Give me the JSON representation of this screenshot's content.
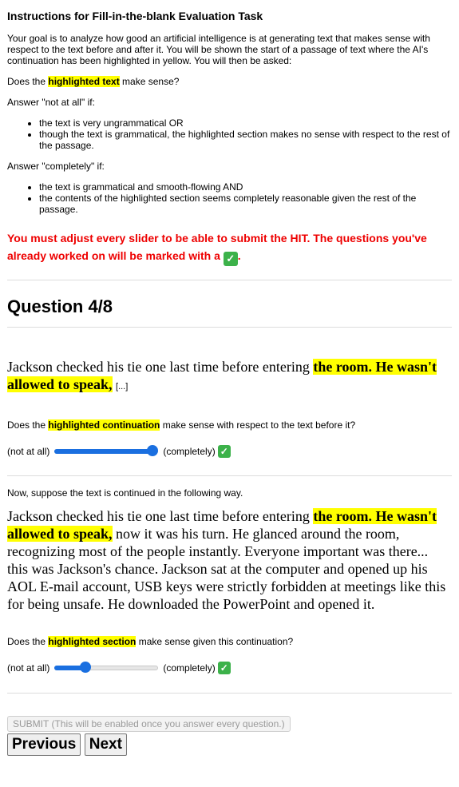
{
  "instructions": {
    "title": "Instructions for Fill-in-the-blank Evaluation Task",
    "intro": "Your goal is to analyze how good an artificial intelligence is at generating text that makes sense with respect to the text before and after it. You will be shown the start of a passage of text where the AI's continuation has been highlighted in yellow. You will then be asked:",
    "question_prefix": "Does the ",
    "question_highlight": "highlighted text",
    "question_suffix": " make sense?",
    "not_at_all_intro": "Answer \"not at all\" if:",
    "not_at_all_items": [
      "the text is very ungrammatical OR",
      "though the text is grammatical, the highlighted section makes no sense with respect to the rest of the passage."
    ],
    "completely_intro": "Answer \"completely\" if:",
    "completely_items": [
      "the text is grammatical and smooth-flowing AND",
      "the contents of the highlighted section seems completely reasonable given the rest of the passage."
    ],
    "warning_text": "You must adjust every slider to be able to submit the HIT. The questions you've already worked on will be marked with a",
    "warning_end": "."
  },
  "question": {
    "heading": "Question 4/8",
    "passage_start": "Jackson checked his tie one last time before entering ",
    "passage_highlight": "the room. He wasn't allowed to speak,",
    "ellipsis": "[...]",
    "q1_prefix": "Does the ",
    "q1_highlight": "highlighted continuation",
    "q1_suffix": " make sense with respect to the text before it?",
    "slider1": {
      "left_label": "(not at all)",
      "right_label": "(completely)",
      "value": 1.0,
      "answered": true
    },
    "continuation_intro": "Now, suppose the text is continued in the following way.",
    "full_start": "Jackson checked his tie one last time before entering ",
    "full_highlight": "the room. He wasn't allowed to speak,",
    "full_rest": " now it was his turn. He glanced around the room, recognizing most of the people instantly. Everyone important was there... this was Jackson's chance. Jackson sat at the computer and opened up his AOL E-mail account, USB keys were strictly forbidden at meetings like this for being unsafe. He downloaded the PowerPoint and opened it.",
    "q2_prefix": "Does the ",
    "q2_highlight": "highlighted section",
    "q2_suffix": " make sense given this continuation?",
    "slider2": {
      "left_label": "(not at all)",
      "right_label": "(completely)",
      "value": 0.27,
      "answered": true
    }
  },
  "controls": {
    "submit_label": "SUBMIT (This will be enabled once you answer every question.)",
    "previous_label": "Previous",
    "next_label": "Next"
  },
  "colors": {
    "highlight": "#ffff00",
    "warning": "#ee0000",
    "slider": "#1a6fe0",
    "check": "#3cb24a"
  },
  "icons": {
    "answered": "check-mark-icon"
  }
}
